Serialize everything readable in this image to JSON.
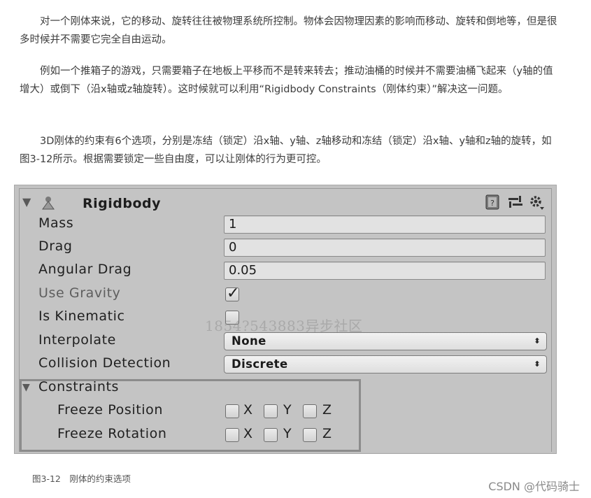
{
  "paragraphs": [
    "对一个刚体来说，它的移动、旋转往往被物理系统所控制。物体会因物理因素的影响而移动、旋转和倒地等，但是很多时候并不需要它完全自由运动。",
    "例如一个推箱子的游戏，只需要箱子在地板上平移而不是转来转去；推动油桶的时候并不需要油桶飞起来（y轴的值增大）或倒下（沿x轴或z轴旋转）。这时候就可以利用“Rigidbody Constraints（刚体约束）”解决这一问题。",
    "3D刚体的约束有6个选项，分别是冻结（锁定）沿x轴、y轴、z轴移动和冻结（锁定）沿x轴、y轴和z轴的旋转，如图3-12所示。根据需要锁定一些自由度，可以让刚体的行为更可控。"
  ],
  "inspector": {
    "component_title": "Rigidbody",
    "fold_glyph": "▼",
    "fields": {
      "mass": {
        "label": "Mass",
        "value": "1"
      },
      "drag": {
        "label": "Drag",
        "value": "0"
      },
      "angular_drag": {
        "label": "Angular Drag",
        "value": "0.05"
      },
      "use_gravity": {
        "label": "Use Gravity",
        "checked": true
      },
      "is_kinematic": {
        "label": "Is Kinematic",
        "checked": false
      },
      "interpolate": {
        "label": "Interpolate",
        "value": "None"
      },
      "collision_detection": {
        "label": "Collision Detection",
        "value": "Discrete"
      }
    },
    "constraints": {
      "label": "Constraints",
      "freeze_position": {
        "label": "Freeze Position",
        "axes": [
          "X",
          "Y",
          "Z"
        ]
      },
      "freeze_rotation": {
        "label": "Freeze Rotation",
        "axes": [
          "X",
          "Y",
          "Z"
        ]
      }
    },
    "dropdown_arrow": "⬍",
    "check_glyph": "✓"
  },
  "watermark": "1854?543883异步社区",
  "caption": "图3-12　刚体的约束选项",
  "credit": "CSDN @代码骑士"
}
